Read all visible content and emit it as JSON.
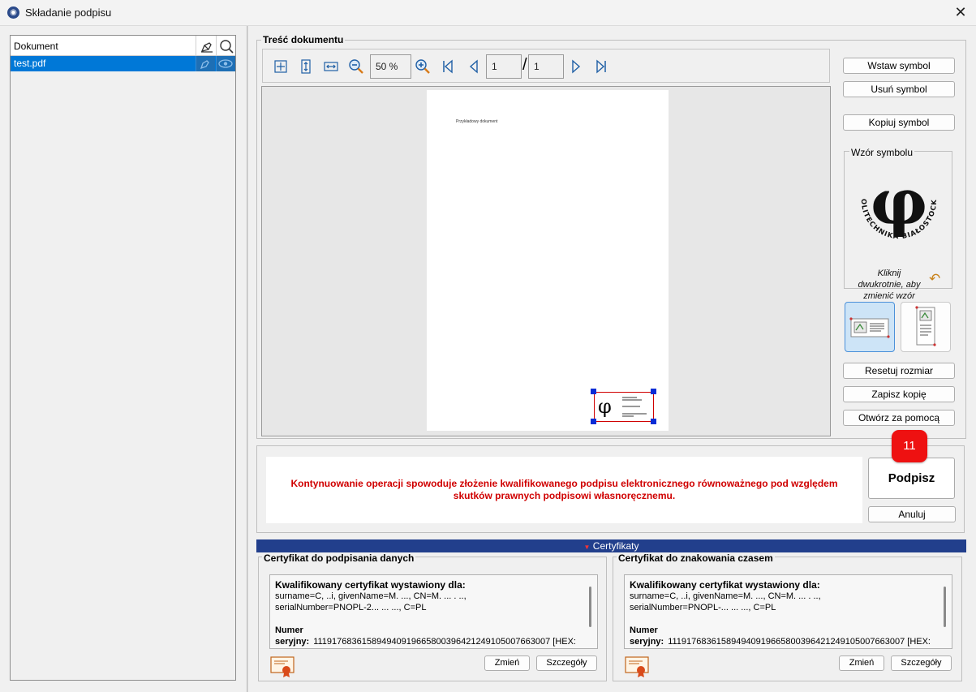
{
  "window": {
    "title": "Składanie podpisu",
    "close_glyph": "✕"
  },
  "documents": {
    "column_header": "Dokument",
    "items": [
      {
        "name": "test.pdf",
        "selected": true
      }
    ],
    "header_icons": [
      "sign-pen-icon",
      "search-icon"
    ],
    "row_icons": [
      "sign-pen-icon",
      "eye-icon"
    ]
  },
  "content": {
    "group_title": "Treść dokumentu",
    "zoom_value": "50 %",
    "current_page": "1",
    "total_pages": "1",
    "page_separator": "/",
    "page_text": "Przykładowy dokument",
    "toolbar_icons": [
      "fit-page-icon",
      "fit-height-icon",
      "fit-width-icon",
      "zoom-out-icon",
      "zoom-in-icon",
      "first-page-icon",
      "prev-page-icon",
      "next-page-icon",
      "last-page-icon"
    ]
  },
  "right_panel": {
    "insert_symbol": "Wstaw symbol",
    "remove_symbol": "Usuń symbol",
    "copy_symbol": "Kopiuj symbol",
    "symbol_group_title": "Wzór symbolu",
    "seal_text": "POLITECHNIKA BIAŁOSTOCKA",
    "seal_glyph": "φ",
    "symbol_hint": "Kliknij dwukrotnie, aby zmienić wzór",
    "reset_size": "Resetuj rozmiar",
    "save_copy": "Zapisz kopię",
    "open_with": "Otwórz za pomocą"
  },
  "confirm": {
    "warning": "Kontynuowanie operacji spowoduje złożenie kwalifikowanego podpisu elektronicznego równoważnego pod względem skutków prawnych podpisowi własnoręcznemu.",
    "sign_label": "Podpisz",
    "cancel_label": "Anuluj",
    "badge": "11"
  },
  "certificates": {
    "bar_label": "Certyfikaty",
    "signing": {
      "title": "Certyfikat do podpisania danych",
      "heading": "Kwalifikowany certyfikat wystawiony dla:",
      "line1": "surname=C,  ..i, givenName=M. ..., CN=M. ...  .  ..,",
      "line2": "serialNumber=PNOPL-2... ... ..., C=PL",
      "serial_label": "Numer seryjny:",
      "serial_value": "111917683615894940919665800396421249105007663007 [HEX:",
      "change_label": "Zmień",
      "details_label": "Szczegóły"
    },
    "timestamp": {
      "title": "Certyfikat do znakowania czasem",
      "heading": "Kwalifikowany certyfikat wystawiony dla:",
      "line1": "surname=C,  ..i, givenName=M. ..., CN=M. ...  .  ..,",
      "line2": "serialNumber=PNOPL-... ... ..., C=PL",
      "serial_label": "Numer seryjny:",
      "serial_value": "111917683615894940919665800396421249105007663007 [HEX:",
      "change_label": "Zmień",
      "details_label": "Szczegóły"
    }
  },
  "colors": {
    "selection": "#0078d7",
    "warning": "#d00000",
    "cert_bar": "#223f8c",
    "badge": "#ee1111"
  }
}
